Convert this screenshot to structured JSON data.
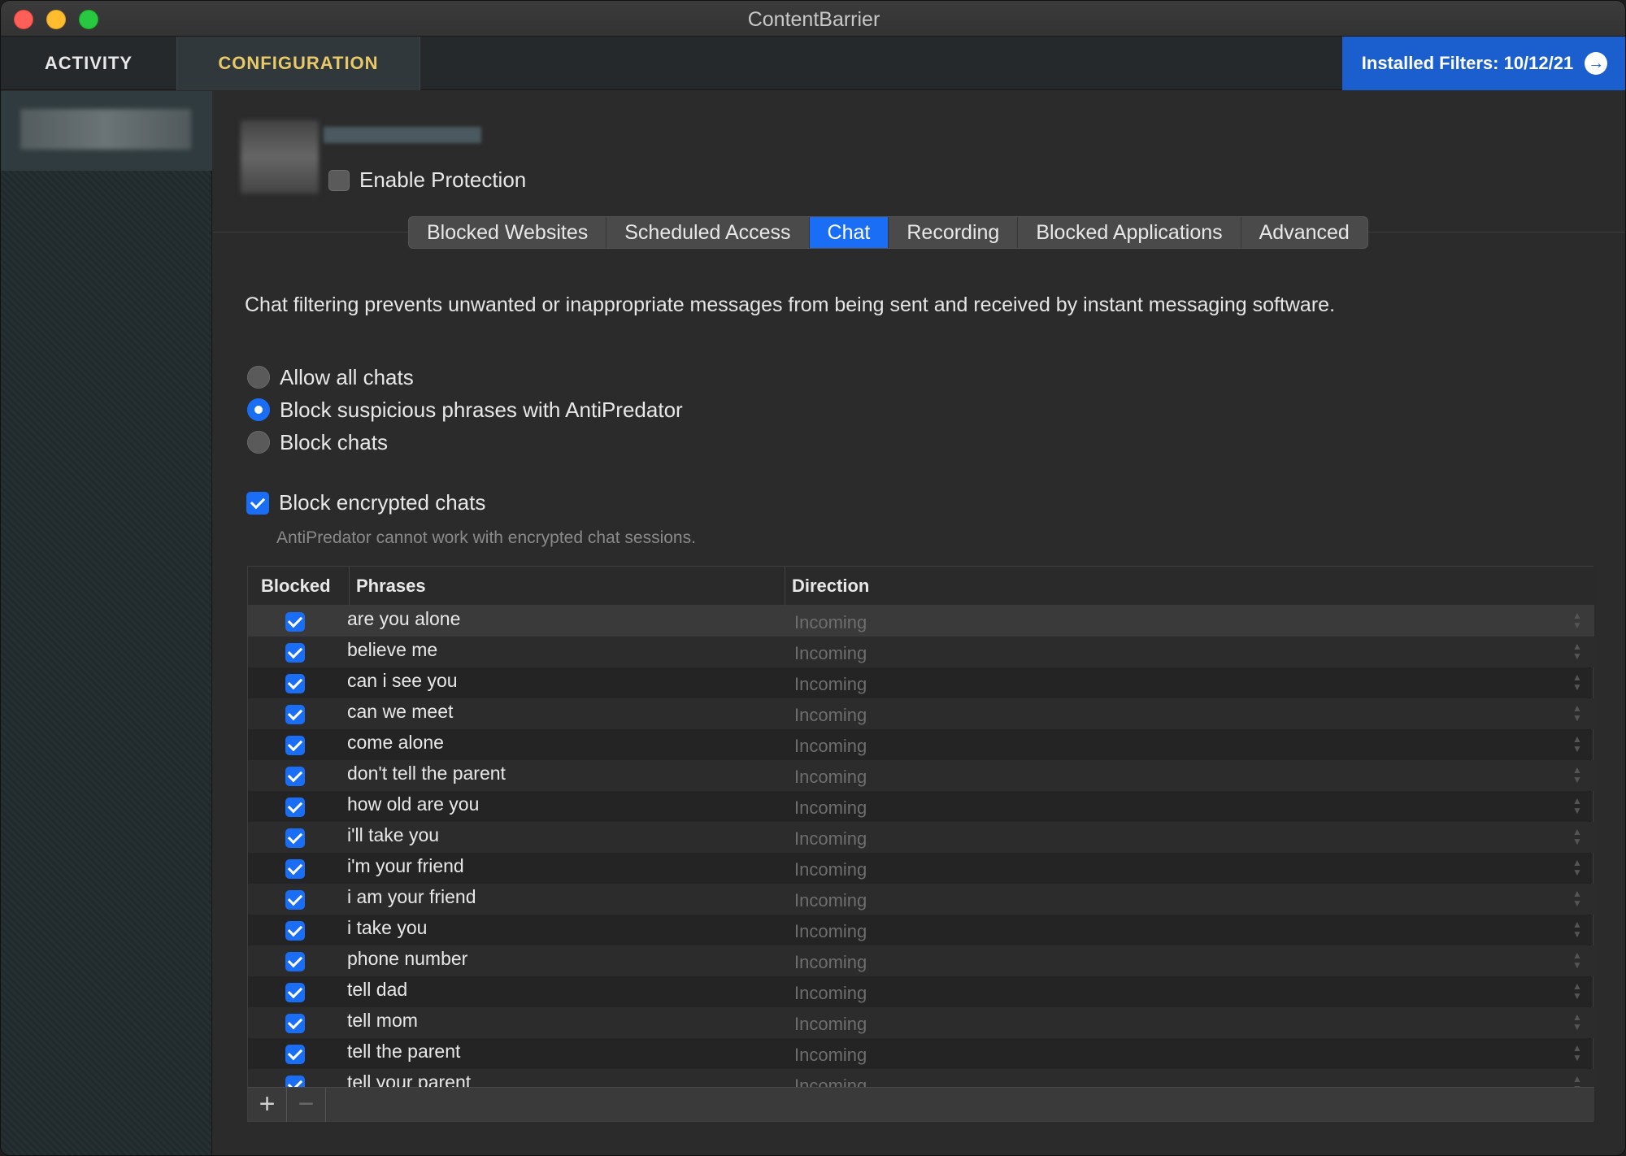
{
  "window": {
    "title": "ContentBarrier"
  },
  "nav": {
    "tabs": [
      {
        "label": "ACTIVITY"
      },
      {
        "label": "CONFIGURATION"
      }
    ],
    "filters_button": "Installed Filters: 10/12/21"
  },
  "profile": {
    "enable_label": "Enable Protection",
    "enabled": false
  },
  "tabs": [
    "Blocked Websites",
    "Scheduled Access",
    "Chat",
    "Recording",
    "Blocked Applications",
    "Advanced"
  ],
  "active_tab": "Chat",
  "chat": {
    "description": "Chat filtering prevents unwanted or inappropriate messages from being sent and received by instant messaging software.",
    "options": [
      {
        "label": "Allow all chats",
        "selected": false
      },
      {
        "label": "Block suspicious phrases with AntiPredator",
        "selected": true
      },
      {
        "label": "Block chats",
        "selected": false
      }
    ],
    "block_encrypted": {
      "label": "Block encrypted chats",
      "checked": true
    },
    "encrypted_note": "AntiPredator cannot work with encrypted chat sessions."
  },
  "table": {
    "columns": [
      "Blocked",
      "Phrases",
      "Direction"
    ],
    "rows": [
      {
        "blocked": true,
        "phrase": "are you alone",
        "direction": "Incoming"
      },
      {
        "blocked": true,
        "phrase": "believe me",
        "direction": "Incoming"
      },
      {
        "blocked": true,
        "phrase": "can i see you",
        "direction": "Incoming"
      },
      {
        "blocked": true,
        "phrase": "can we meet",
        "direction": "Incoming"
      },
      {
        "blocked": true,
        "phrase": "come alone",
        "direction": "Incoming"
      },
      {
        "blocked": true,
        "phrase": "don't tell the parent",
        "direction": "Incoming"
      },
      {
        "blocked": true,
        "phrase": "how old are you",
        "direction": "Incoming"
      },
      {
        "blocked": true,
        "phrase": "i'll take you",
        "direction": "Incoming"
      },
      {
        "blocked": true,
        "phrase": "i'm your friend",
        "direction": "Incoming"
      },
      {
        "blocked": true,
        "phrase": "i am your friend",
        "direction": "Incoming"
      },
      {
        "blocked": true,
        "phrase": "i take you",
        "direction": "Incoming"
      },
      {
        "blocked": true,
        "phrase": "phone number",
        "direction": "Incoming"
      },
      {
        "blocked": true,
        "phrase": "tell dad",
        "direction": "Incoming"
      },
      {
        "blocked": true,
        "phrase": "tell mom",
        "direction": "Incoming"
      },
      {
        "blocked": true,
        "phrase": "tell the parent",
        "direction": "Incoming"
      },
      {
        "blocked": true,
        "phrase": "tell your parent",
        "direction": "Incoming"
      }
    ],
    "add_label": "+",
    "remove_label": "−"
  }
}
